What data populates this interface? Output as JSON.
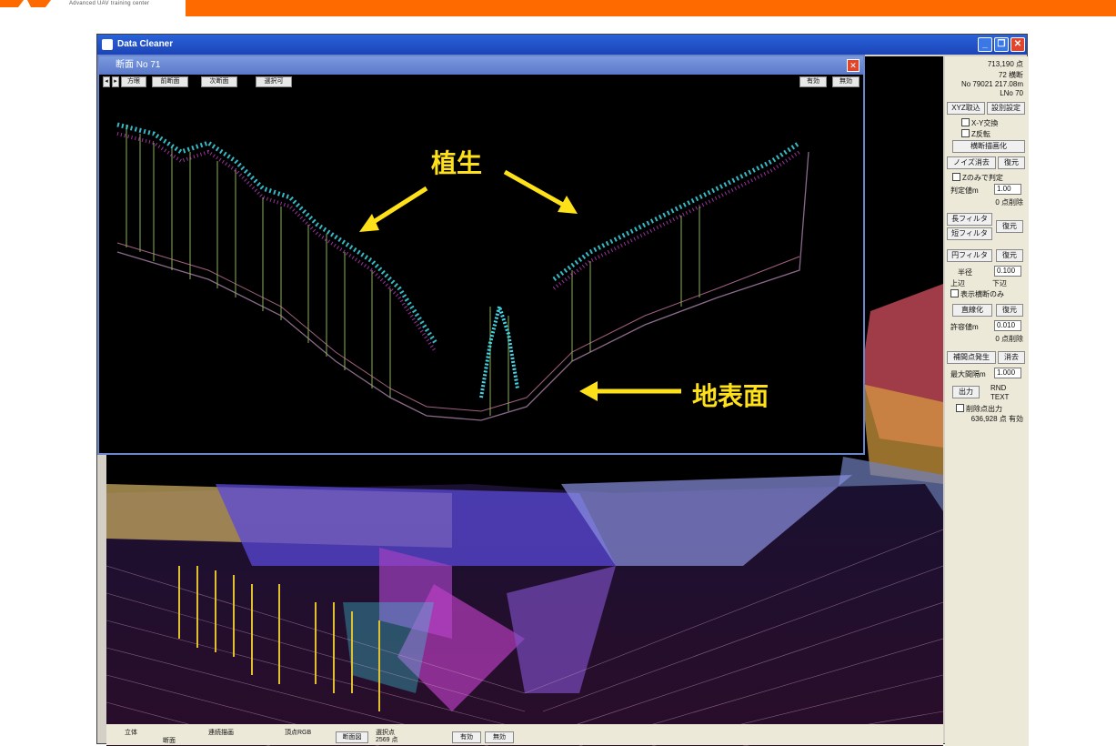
{
  "header": {
    "tagline": "Advanced UAV training center",
    "accent_color": "#ff6a00"
  },
  "window": {
    "title": "Data Cleaner",
    "minimize": "_",
    "restore": "❐",
    "close": "✕"
  },
  "panel": {
    "count_total": "713,190 点",
    "sections": "72 横断",
    "no_line": "No 79021 217.08m",
    "lno": "LNo 70",
    "btn_xyz": "XYZ取込",
    "btn_settings": "設別設定",
    "chk_xy": "X-Y交換",
    "chk_z": "Z反転",
    "btn_cross": "横断描画化",
    "btn_noise": "ノイズ消去",
    "btn_restore1": "復元",
    "chk_zonly": "Zのみで判定",
    "threshold_label": "判定値m",
    "threshold_value": "1.00",
    "deleted1": "0 点削除",
    "btn_long": "長フィルタ",
    "btn_short": "短フィルタ",
    "btn_restore2": "復元",
    "btn_circle": "円フィルタ",
    "btn_restore3": "復元",
    "radius_label": "半径",
    "radius_value": "0.100",
    "radio_upper": "上辺",
    "radio_lower": "下辺",
    "chk_display": "表示横断のみ",
    "btn_linear": "直線化",
    "btn_restore4": "復元",
    "tol_label": "許容値m",
    "tol_value": "0.010",
    "deleted2": "0 点削除",
    "btn_interp": "補間点発生",
    "btn_erase": "消去",
    "max_int_label": "最大間隔m",
    "max_int_value": "1.000",
    "btn_output": "出力",
    "radio_rnd": "RND",
    "radio_text": "TEXT",
    "chk_delete_out": "削除点出力",
    "valid_count": "636,928 点 有効"
  },
  "bottom": {
    "chk_3d": "立体",
    "chk_section": "断面",
    "chk_continuous": "連続描画",
    "chk_rgb": "頂点RGB",
    "btn_section_view": "断面図",
    "select_label": "選択点",
    "select_count": "2569 点",
    "btn_valid": "有効",
    "btn_invalid": "無効"
  },
  "subwindow": {
    "title": "断面 No 71",
    "btn_dir": "方眼",
    "btn_prev": "前断面",
    "btn_next": "次断面",
    "btn_select": "選択可",
    "btn_valid": "有効",
    "btn_invalid": "無効",
    "label_vegetation": "植生",
    "label_ground": "地表面"
  }
}
